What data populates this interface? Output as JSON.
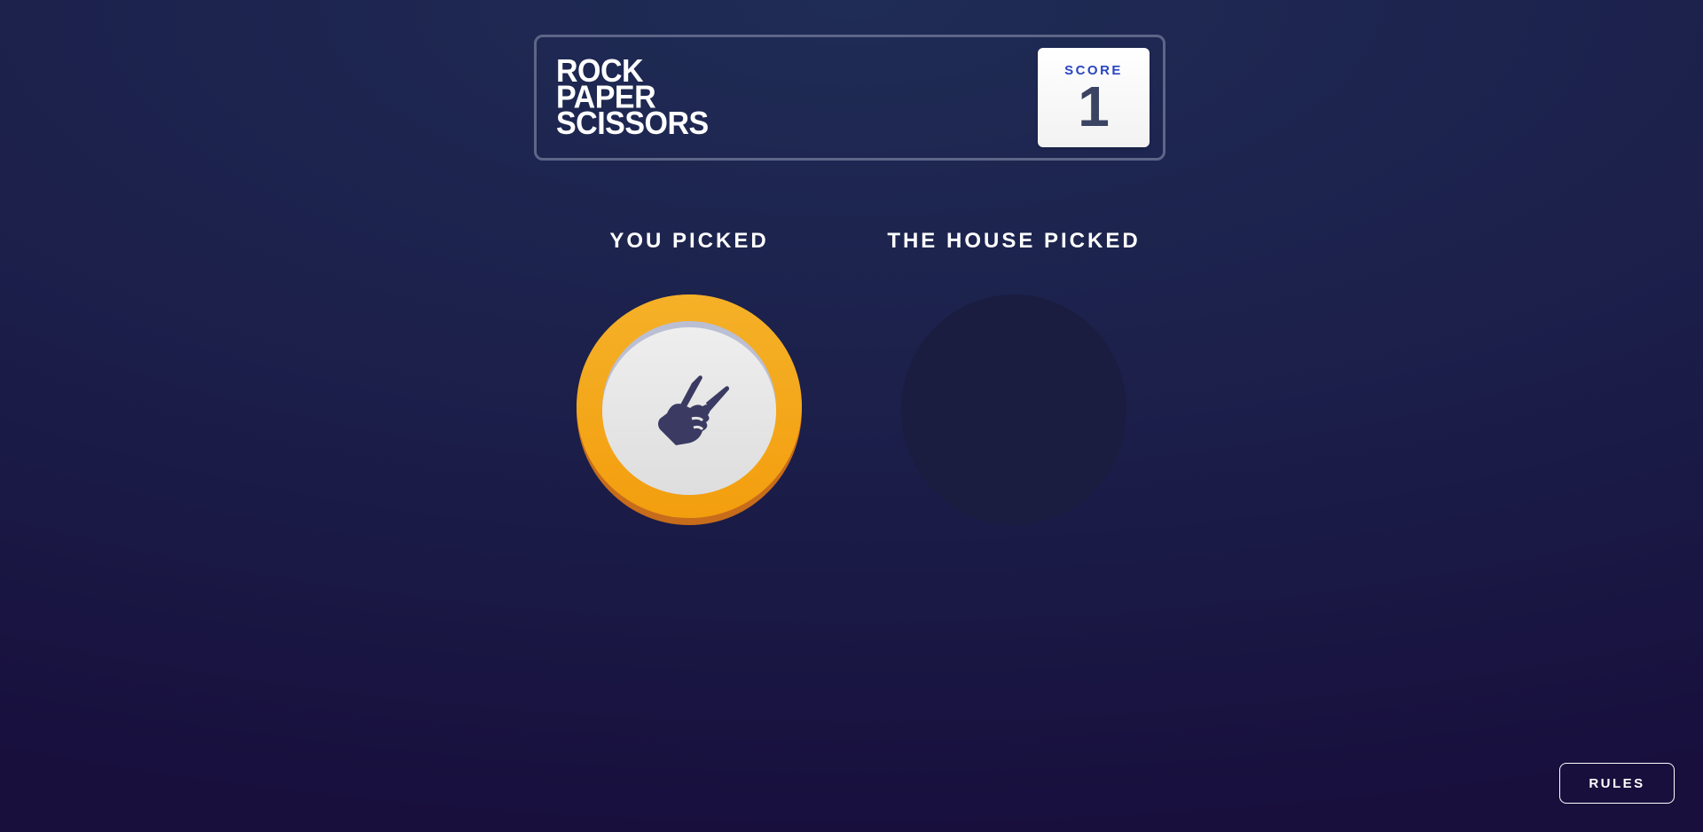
{
  "header": {
    "title_lines": [
      "ROCK",
      "PAPER",
      "SCISSORS"
    ],
    "score": {
      "label": "SCORE",
      "value": "1"
    }
  },
  "game": {
    "you_picked_label": "YOU PICKED",
    "house_picked_label": "THE HOUSE PICKED",
    "player_choice": {
      "name": "scissors",
      "icon": "scissors-hand-icon",
      "ring_color": "#f4a51b"
    },
    "house_choice": null
  },
  "footer": {
    "rules_label": "RULES"
  },
  "colors": {
    "score_label": "#2a45c2",
    "score_value": "#3b4363",
    "header_border": "#5d6688",
    "background_top": "#1f2c55",
    "background_bottom": "#180f3d",
    "house_placeholder": "#1a1d40"
  }
}
